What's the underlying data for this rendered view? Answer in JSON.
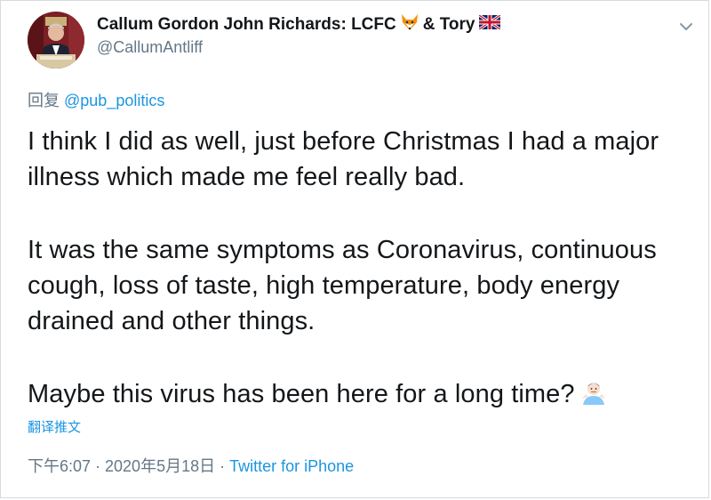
{
  "tweet": {
    "author": {
      "display_name": "Callum Gordon John Richards: LCFC",
      "display_name_suffix": "& Tory",
      "handle": "@CallumAntliff",
      "avatar_icon": "profile-photo",
      "fox_emoji": "fox-face-icon",
      "flag_emoji": "uk-flag-icon"
    },
    "reply": {
      "prefix": "回复",
      "mention": "@pub_politics"
    },
    "body": {
      "paragraph_1": "I think I did as well, just before Christmas I had a major illness which made me feel really bad.",
      "paragraph_2": "It was the same symptoms as Coronavirus, continuous cough, loss of taste, high temperature, body energy drained and other things.",
      "paragraph_3": "Maybe this virus has been here for a long time?",
      "paragraph_3_emoji": "person-shrugging-icon"
    },
    "translate_label": "翻译推文",
    "meta": {
      "timestamp": "下午6:07 · 2020年5月18日",
      "separator": " · ",
      "source": "Twitter for iPhone"
    }
  },
  "colors": {
    "text": "#14171a",
    "secondary": "#657786",
    "link": "#1b95e0",
    "border": "#d6dbe0"
  }
}
